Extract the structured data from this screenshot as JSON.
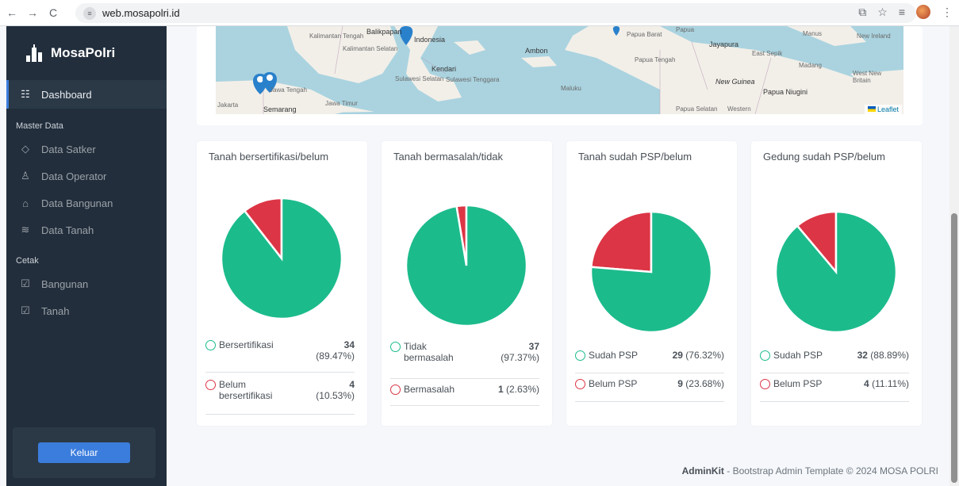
{
  "browser": {
    "url": "web.mosapolri.id",
    "back": "←",
    "forward": "→",
    "reload": "C"
  },
  "sidebar": {
    "brand": "MosaPolri",
    "items": [
      {
        "label": "Dashboard",
        "icon": "sliders-icon",
        "glyph": "☷"
      }
    ],
    "section_master": "Master Data",
    "master_items": [
      {
        "label": "Data Satker",
        "glyph": "◇"
      },
      {
        "label": "Data Operator",
        "glyph": "♙"
      },
      {
        "label": "Data Bangunan",
        "glyph": "⌂"
      },
      {
        "label": "Data Tanah",
        "glyph": "≋"
      }
    ],
    "section_cetak": "Cetak",
    "cetak_items": [
      {
        "label": "Bangunan",
        "glyph": "☑"
      },
      {
        "label": "Tanah",
        "glyph": "☑"
      }
    ],
    "logout_label": "Keluar"
  },
  "map": {
    "attribution": "Leaflet",
    "labels": {
      "jakarta": "Jakarta",
      "semarang": "Semarang",
      "jawa_tengah": "Jawa Tengah",
      "jawa_timur": "Jawa Timur",
      "kalimantan_tengah": "Kalimantan Tengah",
      "kalimantan_selatan": "Kalimantan Selatan",
      "balikpapan": "Balikpapan",
      "indonesia": "Indonesia",
      "kendari": "Kendari",
      "sulawesi_selatan": "Sulawesi Selatan",
      "sulawesi_tenggara": "Sulawesi Tenggara",
      "ambon": "Ambon",
      "maluku": "Maluku",
      "papua_barat": "Papua Barat",
      "papua": "Papua",
      "papua_tengah": "Papua Tengah",
      "jayapura": "Jayapura",
      "new_guinea": "New Guinea",
      "papua_niugini": "Papua Niugini",
      "papua_selatan": "Papua Selatan",
      "western": "Western",
      "east_sepik": "East Sepik",
      "madang": "Madang",
      "manus": "Manus",
      "new_ireland": "New Ireland",
      "west_new_britain": "West New Britain"
    }
  },
  "cards": [
    {
      "title": "Tanah bersertifikasi/belum",
      "rows": [
        {
          "label": "Bersertifikasi",
          "count": "34",
          "pct": "(89.47%)",
          "color": "#1cbb8c"
        },
        {
          "label": "Belum bersertifikasi",
          "count": "4",
          "pct": "(10.53%)",
          "color": "#dc3545"
        }
      ]
    },
    {
      "title": "Tanah bermasalah/tidak",
      "rows": [
        {
          "label": "Tidak bermasalah",
          "count": "37",
          "pct": "(97.37%)",
          "color": "#1cbb8c"
        },
        {
          "label": "Bermasalah",
          "count": "1",
          "pct": "(2.63%)",
          "color": "#dc3545"
        }
      ]
    },
    {
      "title": "Tanah sudah PSP/belum",
      "rows": [
        {
          "label": "Sudah PSP",
          "count": "29",
          "pct": "(76.32%)",
          "color": "#1cbb8c"
        },
        {
          "label": "Belum PSP",
          "count": "9",
          "pct": "(23.68%)",
          "color": "#dc3545"
        }
      ]
    },
    {
      "title": "Gedung sudah PSP/belum",
      "rows": [
        {
          "label": "Sudah PSP",
          "count": "32",
          "pct": "(88.89%)",
          "color": "#1cbb8c"
        },
        {
          "label": "Belum PSP",
          "count": "4",
          "pct": "(11.11%)",
          "color": "#dc3545"
        }
      ]
    }
  ],
  "chart_data": [
    {
      "type": "pie",
      "title": "Tanah bersertifikasi/belum",
      "categories": [
        "Bersertifikasi",
        "Belum bersertifikasi"
      ],
      "values": [
        34,
        4
      ],
      "colors": [
        "#1cbb8c",
        "#dc3545"
      ]
    },
    {
      "type": "pie",
      "title": "Tanah bermasalah/tidak",
      "categories": [
        "Tidak bermasalah",
        "Bermasalah"
      ],
      "values": [
        37,
        1
      ],
      "colors": [
        "#1cbb8c",
        "#dc3545"
      ]
    },
    {
      "type": "pie",
      "title": "Tanah sudah PSP/belum",
      "categories": [
        "Sudah PSP",
        "Belum PSP"
      ],
      "values": [
        29,
        9
      ],
      "colors": [
        "#1cbb8c",
        "#dc3545"
      ]
    },
    {
      "type": "pie",
      "title": "Gedung sudah PSP/belum",
      "categories": [
        "Sudah PSP",
        "Belum PSP"
      ],
      "values": [
        32,
        4
      ],
      "colors": [
        "#1cbb8c",
        "#dc3545"
      ]
    }
  ],
  "footer": {
    "brand": "AdminKit",
    "rest": " - Bootstrap Admin Template © 2024 MOSA POLRI"
  }
}
